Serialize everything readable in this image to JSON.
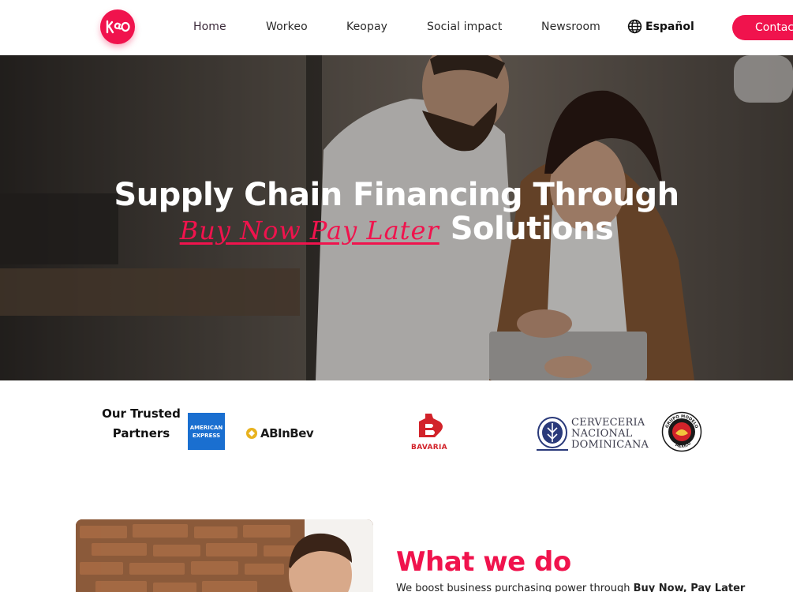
{
  "header": {
    "logo_alt": "keo",
    "nav": [
      "Home",
      "Workeo",
      "Keopay",
      "Social impact",
      "Newsroom"
    ],
    "language": "Español",
    "contact_label": "Contact"
  },
  "hero": {
    "title_line1": "Supply Chain Financing Through",
    "highlight": "Buy Now Pay Later",
    "title_line2_rest": "Solutions"
  },
  "partners": {
    "label": "Our Trusted Partners",
    "logos": {
      "amex": "AMERICAN EXPRESS",
      "abinbev": "ABInBev",
      "bavaria": "BAVARIA",
      "cnd_line1": "CERVECERIA",
      "cnd_line2": "NACIONAL",
      "cnd_line3": "DOMINICANA",
      "modelo": "GRUPO MODELO MEXICO"
    }
  },
  "what_we_do": {
    "title": "What we do",
    "desc_prefix": "We boost business purchasing power through ",
    "desc_bold": "Buy Now, Pay Later"
  },
  "colors": {
    "brand": "#f0134d",
    "text": "#111111",
    "amex_blue": "#1a6fd0",
    "bavaria_red": "#d2232a"
  },
  "icons": {
    "language": "globe-icon",
    "logo": "keo-logo-icon"
  }
}
